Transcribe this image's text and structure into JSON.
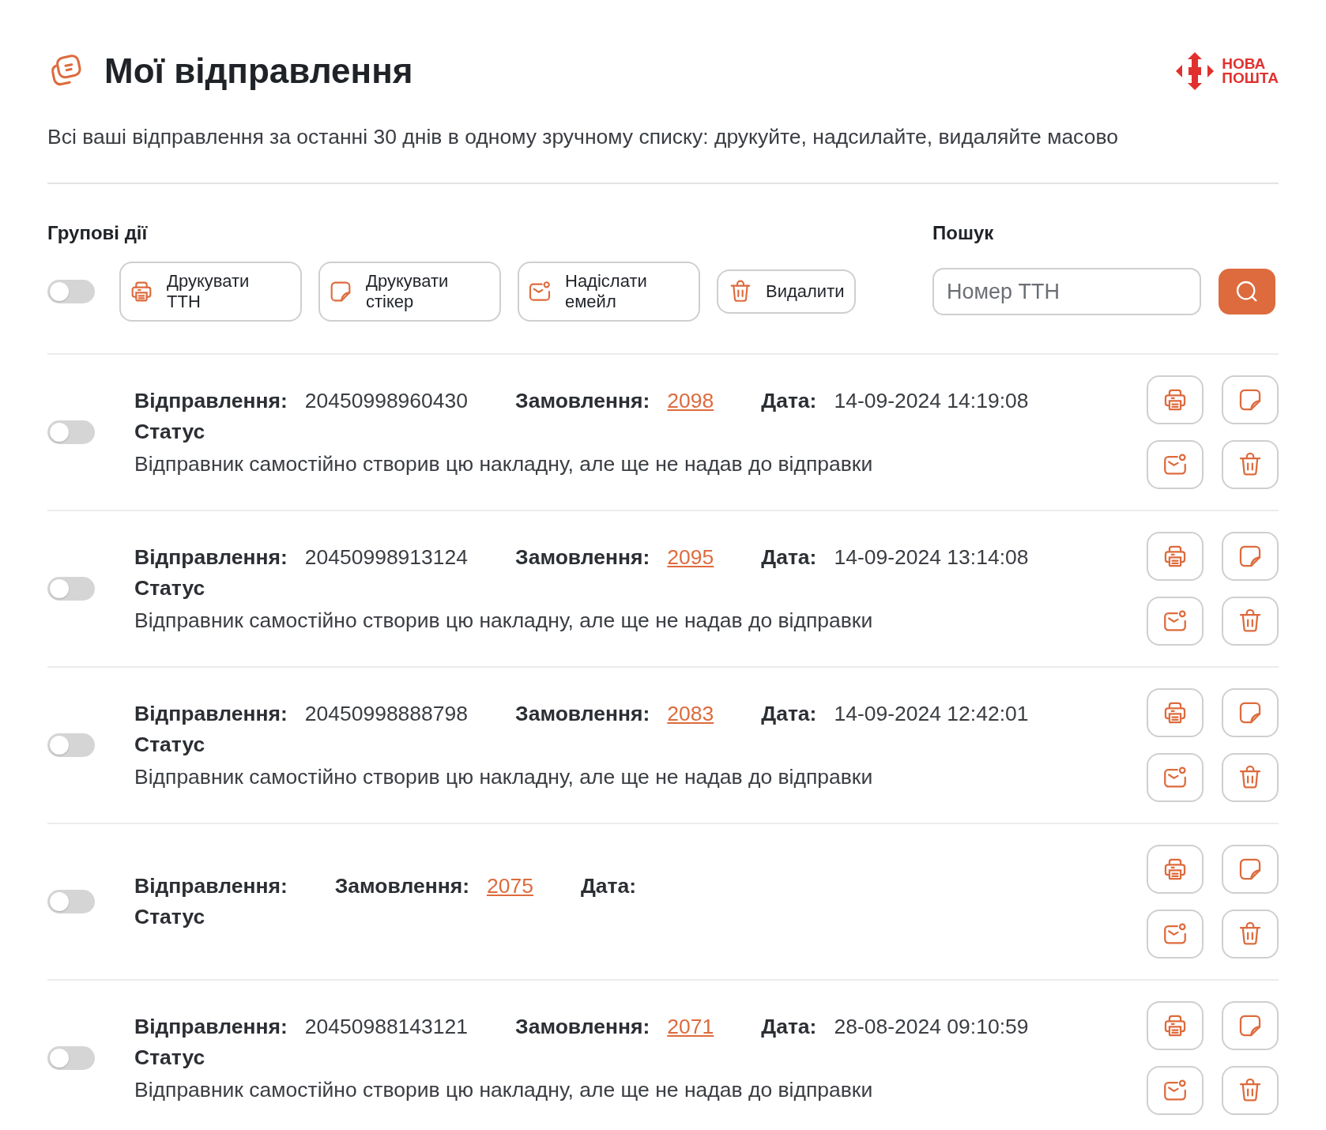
{
  "header": {
    "title": "Мої відправлення",
    "brand": [
      "НОВА",
      "ПОШТА"
    ],
    "subtitle": "Всі ваші відправлення за останні 30 днів в одному зручному списку: друкуйте, надсилайте, видаляйте масово"
  },
  "bulk_actions": {
    "heading": "Групові дії",
    "toggle_on": false,
    "buttons": [
      {
        "kind": "print",
        "label": "Друкувати ТТН"
      },
      {
        "kind": "sticker",
        "label": "Друкувати стікер"
      },
      {
        "kind": "email",
        "label": "Надіслати емейл"
      },
      {
        "kind": "delete",
        "label": "Видалити"
      }
    ]
  },
  "search": {
    "heading": "Пошук",
    "placeholder": "Номер ТТН"
  },
  "shipments": [
    {
      "selected": false,
      "shipment_label": "Відправлення:",
      "number": "20450998960430",
      "order_label": "Замовлення:",
      "order": "2098",
      "date_label": "Дата:",
      "date": "14-09-2024 14:19:08",
      "status_label": "Статус",
      "status": "Відправник самостійно створив цю накладну, але ще не надав до відправки"
    },
    {
      "selected": false,
      "shipment_label": "Відправлення:",
      "number": "20450998913124",
      "order_label": "Замовлення:",
      "order": "2095",
      "date_label": "Дата:",
      "date": "14-09-2024 13:14:08",
      "status_label": "Статус",
      "status": "Відправник самостійно створив цю накладну, але ще не надав до відправки"
    },
    {
      "selected": false,
      "shipment_label": "Відправлення:",
      "number": "20450998888798",
      "order_label": "Замовлення:",
      "order": "2083",
      "date_label": "Дата:",
      "date": "14-09-2024 12:42:01",
      "status_label": "Статус",
      "status": "Відправник самостійно створив цю накладну, але ще не надав до відправки"
    },
    {
      "selected": false,
      "shipment_label": "Відправлення:",
      "order_label": "Замовлення:",
      "order": "2075",
      "date_label": "Дата:",
      "status_label": "Статус"
    },
    {
      "selected": false,
      "shipment_label": "Відправлення:",
      "number": "20450988143121",
      "order_label": "Замовлення:",
      "order": "2071",
      "date_label": "Дата:",
      "date": "28-08-2024 09:10:59",
      "status_label": "Статус",
      "status": "Відправник самостійно створив цю накладну, але ще не надав до відправки"
    }
  ]
}
